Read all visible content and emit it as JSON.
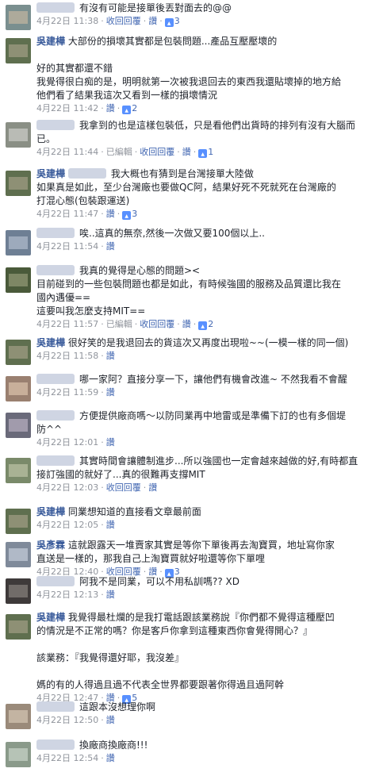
{
  "ui": {
    "reply": "收回回覆",
    "like": "讚",
    "edited": "已編輯",
    "sep": "·",
    "thumb": "👍"
  },
  "comments": [
    {
      "name": "",
      "lines": [
        "有沒有可能是接單後丟對面去的@@"
      ],
      "time": "4月22日 11:38",
      "actions": [
        "reply",
        "like"
      ],
      "likes": "3",
      "edited": false
    },
    {
      "name": "吳建樺",
      "lines": [
        "大部份的損壞其實都是包裝問題...產品互壓壓壞的",
        "",
        "好的其實都還不錯",
        "我覺得很白痴的是，明明就第一次被我退回去的東西我還貼壞掉的地方給",
        "他們看了結果我這次又看到一樣的損壞情況"
      ],
      "time": "4月22日 11:42",
      "actions": [
        "like"
      ],
      "likes": "2",
      "edited": false
    },
    {
      "name": "",
      "lines": [
        "我拿到的也是這樣包裝低，只是看他們出貨時的排列有沒有大腦而",
        "已。"
      ],
      "time": "4月22日 11:44",
      "actions": [
        "reply",
        "like"
      ],
      "likes": "1",
      "edited": true
    },
    {
      "name": "吳建樺",
      "tag": true,
      "lines": [
        "我大概也有猜到是台灣接單大陸做",
        "如果真是如此，至少台灣廠也要做QC阿，結果好死不死就死在台灣廠的",
        "打混心態(包裝跟運送)"
      ],
      "time": "4月22日 11:47",
      "actions": [
        "like"
      ],
      "likes": "3",
      "edited": false
    },
    {
      "name": "",
      "lines": [
        "唉..這真的無奈,然後一次做又要100個以上.."
      ],
      "time": "4月22日 11:54",
      "actions": [
        "like"
      ],
      "likes": "",
      "edited": false
    },
    {
      "name": "",
      "lines": [
        "我真的覺得是心態的問題><",
        "目前碰到的一些包裝問題也都是如此，有時候強國的服務及品質還比我在",
        "國內遇優==",
        "這要叫我怎麼支持MIT=="
      ],
      "time": "4月22日 11:57",
      "actions": [
        "reply",
        "like"
      ],
      "likes": "2",
      "edited": true
    },
    {
      "name": "吳建樺",
      "lines": [
        "很好笑的是我退回去的貨這次又再度出現啦~~(一模一樣的同一個)"
      ],
      "time": "4月22日 11:58",
      "actions": [
        "like"
      ],
      "likes": "",
      "edited": false
    },
    {
      "name": "",
      "lines": [
        "哪一家阿？直接分享一下，讓他們有機會改進~ 不然我看不會醒"
      ],
      "time": "4月22日 11:59",
      "actions": [
        "like"
      ],
      "likes": "",
      "edited": false
    },
    {
      "name": "",
      "lines": [
        "方便提供廠商嗎～以防同業再中地雷或是準備下訂的也有多個堤",
        "防^^"
      ],
      "time": "4月22日 12:01",
      "actions": [
        "like"
      ],
      "likes": "",
      "edited": false
    },
    {
      "name": "",
      "lines": [
        "其實時間會讓體制進步...所以強國也一定會越來越做的好,有時都直",
        "接訂強國的就好了...真的很難再支撐MIT"
      ],
      "time": "4月22日 12:03",
      "actions": [
        "reply",
        "like"
      ],
      "likes": "",
      "edited": false
    },
    {
      "name": "吳建樺",
      "lines": [
        "同業想知道的直接看文章最前面"
      ],
      "time": "4月22日 12:05",
      "actions": [
        "like"
      ],
      "likes": "",
      "edited": false
    },
    {
      "name": "吳彥霖",
      "lines": [
        "這就跟露天一堆賣家其實是等你下單後再去淘寶買，地址寫你家",
        "直送是一樣的，那我自己上淘寶買就好啦還等你下單哩"
      ],
      "time": "4月22日 12:40",
      "actions": [
        "reply",
        "like"
      ],
      "likes": "3",
      "edited": false
    },
    {
      "name": "",
      "lines": [
        "阿我不是同業，可以不用私訓嗎?? XD"
      ],
      "time": "4月22日 12:13",
      "actions": [
        "like"
      ],
      "likes": "",
      "edited": false
    },
    {
      "name": "吳建樺",
      "lines": [
        "我覺得最杜爛的是我打電話跟該業務說『你們都不覺得這種壓凹",
        "的情況是不正常的嗎？你是客戶你拿到這種東西你會覺得開心？』",
        "",
        "該業務：『我覺得還好耶，我沒差』",
        "",
        "媽的有的人得過且過不代表全世界都要跟著你得過且過阿幹"
      ],
      "time": "4月22日 12:47",
      "actions": [
        "like"
      ],
      "likes": "5",
      "edited": false
    },
    {
      "name": "",
      "lines": [
        "這跟本沒想理你啊"
      ],
      "time": "4月22日 12:50",
      "actions": [
        "like"
      ],
      "likes": "",
      "edited": false
    },
    {
      "name": "",
      "lines": [
        "換廠商換廠商!!!"
      ],
      "time": "4月22日 12:54",
      "actions": [
        "like"
      ],
      "likes": "",
      "edited": false
    }
  ],
  "avatar_colors": [
    [
      "#7a8f8f",
      "#c9b8a2"
    ],
    [
      "#5f6f4f",
      "#a8a28a"
    ],
    [
      "#8a8f85",
      "#d2d3cf"
    ],
    [
      "#5f6f4f",
      "#a8a28a"
    ],
    [
      "#6e7f94",
      "#b7c2d1"
    ],
    [
      "#4a5a3a",
      "#9aa07c"
    ],
    [
      "#5f6f4f",
      "#a8a28a"
    ],
    [
      "#9a8070",
      "#e0c8b0"
    ],
    [
      "#6a6a7a",
      "#bfb6c8"
    ],
    [
      "#7a8a6a",
      "#c3c8aa"
    ],
    [
      "#5f6f4f",
      "#a8a28a"
    ],
    [
      "#7f8a9a",
      "#cbd3de"
    ],
    [
      "#3e3a3a",
      "#8d8782"
    ],
    [
      "#5f6f4f",
      "#a8a28a"
    ],
    [
      "#9a8a7a",
      "#d9cbb8"
    ],
    [
      "#8a9a8a",
      "#ced8ce"
    ]
  ]
}
